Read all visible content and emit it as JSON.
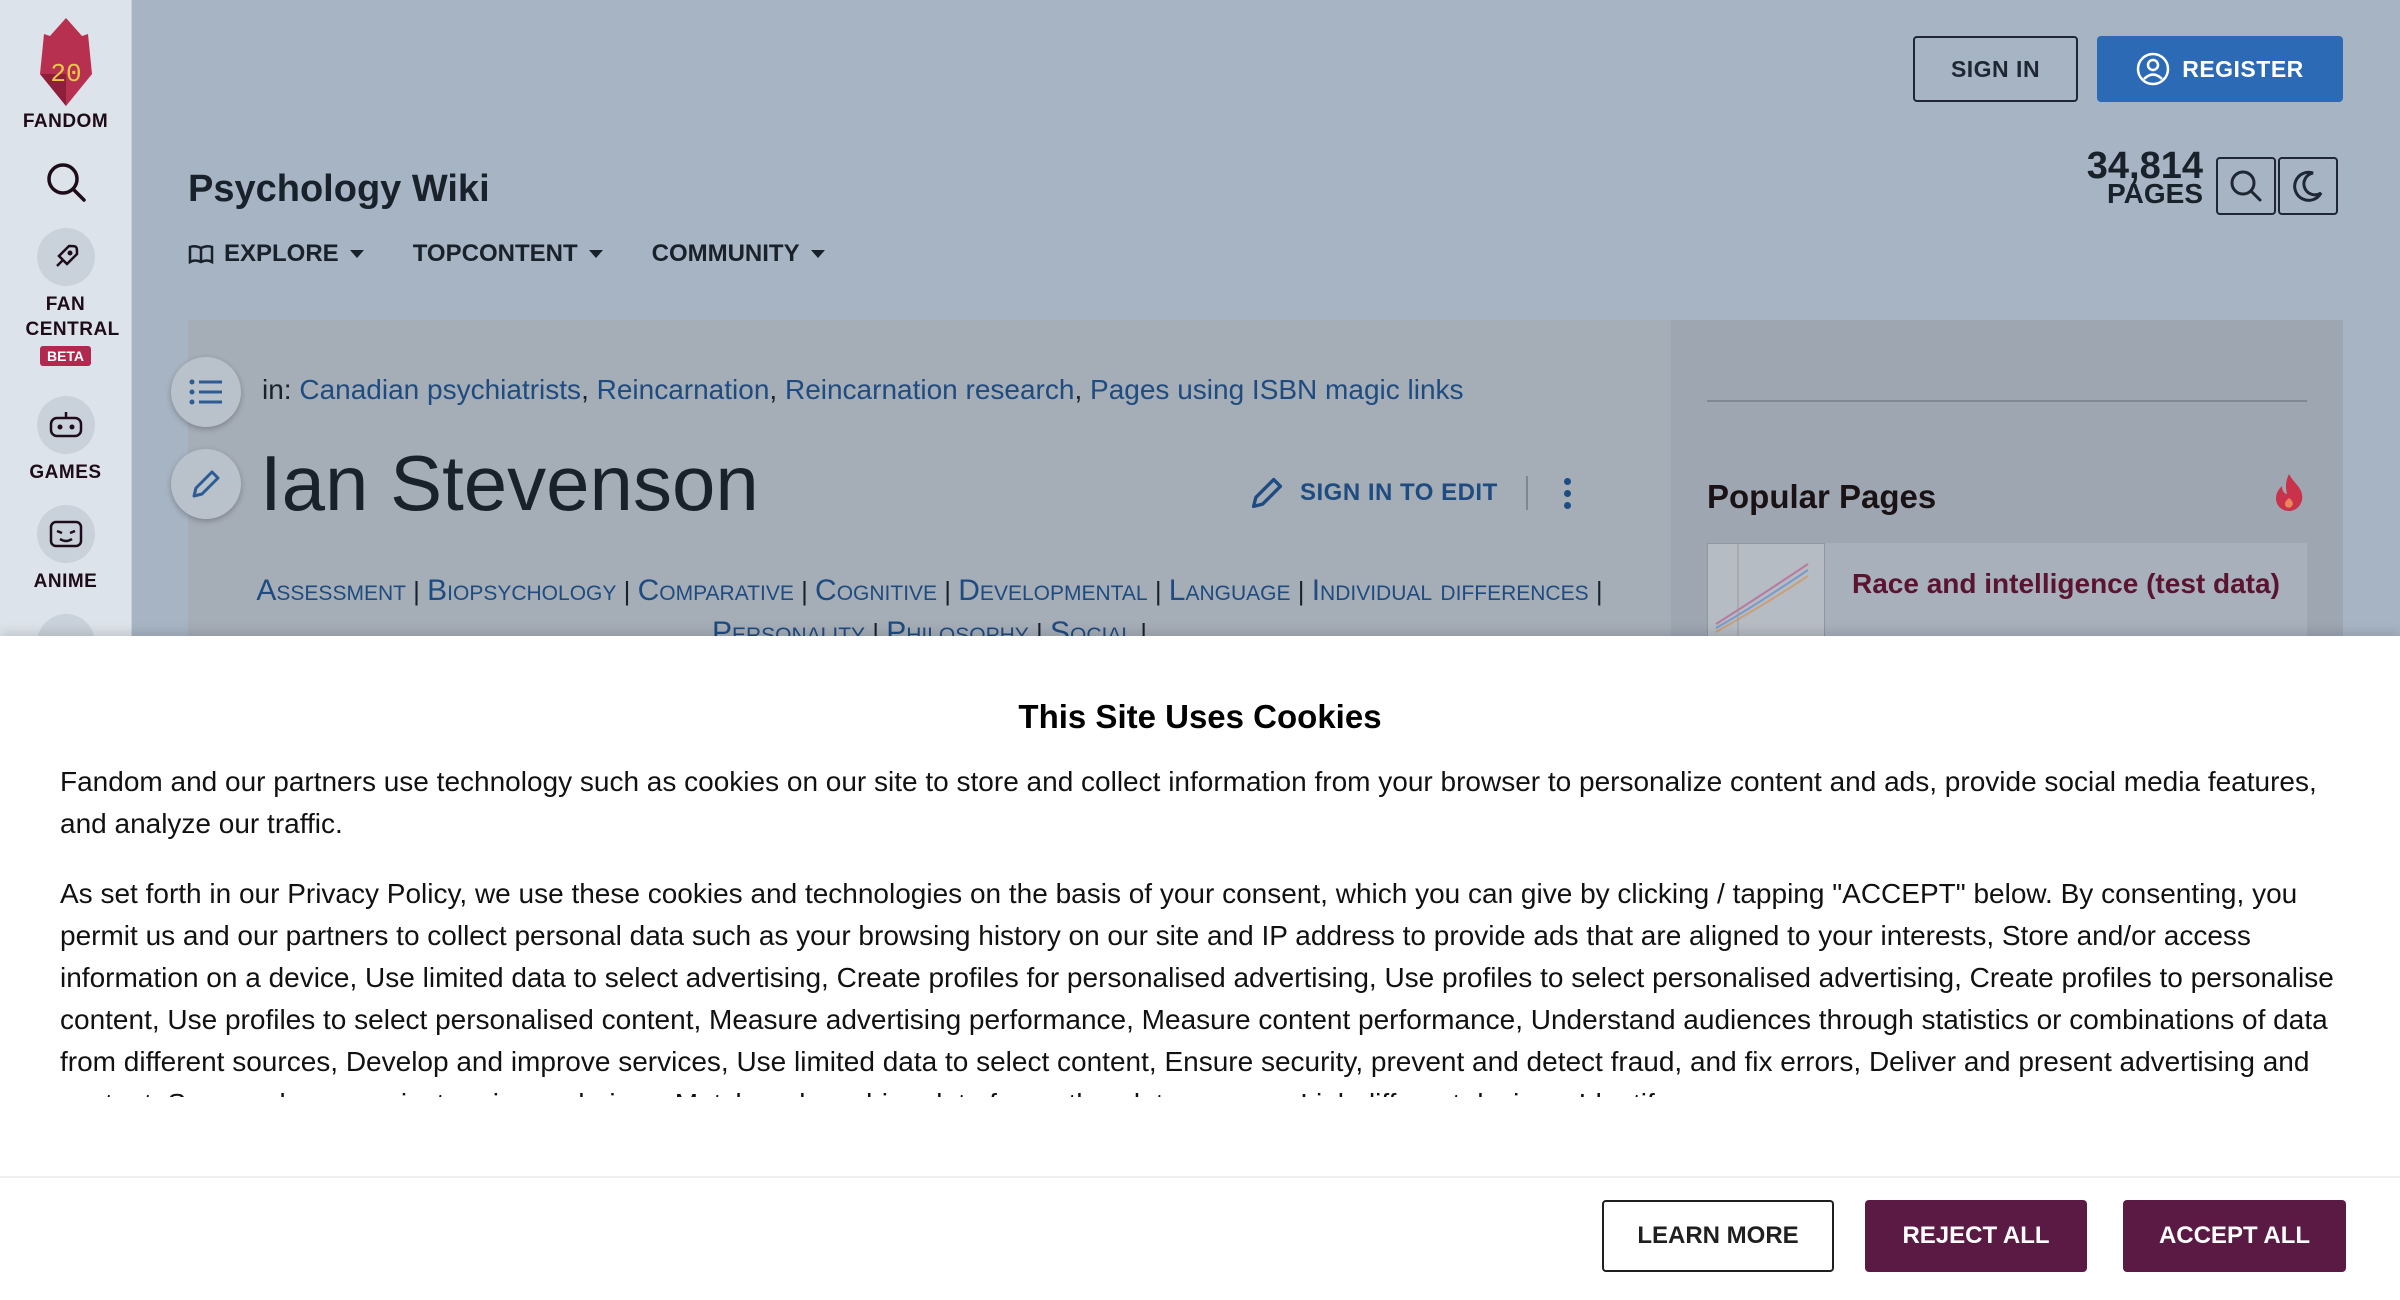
{
  "rail": {
    "logo_number": "20",
    "logo_label": "FANDOM",
    "items": [
      {
        "label": "FAN CENTRAL",
        "badge": "BETA"
      },
      {
        "label": "GAMES"
      },
      {
        "label": "ANIME"
      }
    ]
  },
  "header": {
    "sign_in": "SIGN IN",
    "register": "REGISTER",
    "wiki_title": "Psychology Wiki",
    "page_count": "34,814",
    "page_count_label": "PAGES",
    "nav": [
      "EXPLORE",
      "TOPCONTENT",
      "COMMUNITY"
    ]
  },
  "article": {
    "categories_prefix": "in:",
    "categories": [
      "Canadian psychiatrists",
      "Reincarnation",
      "Reincarnation research",
      "Pages using ISBN magic links"
    ],
    "title": "Ian Stevenson",
    "edit_label": "SIGN IN TO EDIT",
    "topics": [
      "Assessment",
      "Biopsychology",
      "Comparative",
      "Cognitive",
      "Developmental",
      "Language",
      "Individual differences",
      "Personality",
      "Philosophy",
      "Social"
    ]
  },
  "sidebar": {
    "popular_title": "Popular Pages",
    "popular_items": [
      {
        "title": "Race and intelligence (test data)"
      }
    ]
  },
  "cookie": {
    "title": "This Site Uses Cookies",
    "para1": "Fandom and our partners use technology such as cookies on our site to store and collect information from your browser to personalize content and ads, provide social media features, and analyze our traffic.",
    "para2": "As set forth in our Privacy Policy, we use these cookies and technologies on the basis of your consent, which you can give by clicking / tapping \"ACCEPT\" below. By consenting, you permit us and our partners to collect personal data such as your browsing history on our site and IP address to provide ads that are aligned to your interests, Store and/or access information on a device, Use limited data to select advertising, Create profiles for personalised advertising, Use profiles to select personalised advertising, Create profiles to personalise content, Use profiles to select personalised content, Measure advertising performance, Measure content performance, Understand audiences through statistics or combinations of data from different sources, Develop and improve services, Use limited data to select content, Ensure security, prevent and detect fraud, and fix errors, Deliver and present advertising and content, Save and communicate privacy choices, Match and combine data from other data sources, Link different devices, Identify",
    "learn_more": "LEARN MORE",
    "reject_all": "REJECT ALL",
    "accept_all": "ACCEPT ALL"
  },
  "colors": {
    "overlay": "#a7b4c3",
    "register": "#2d6ab5",
    "consent_button": "#5b1a44",
    "link": "#1e4b80"
  }
}
